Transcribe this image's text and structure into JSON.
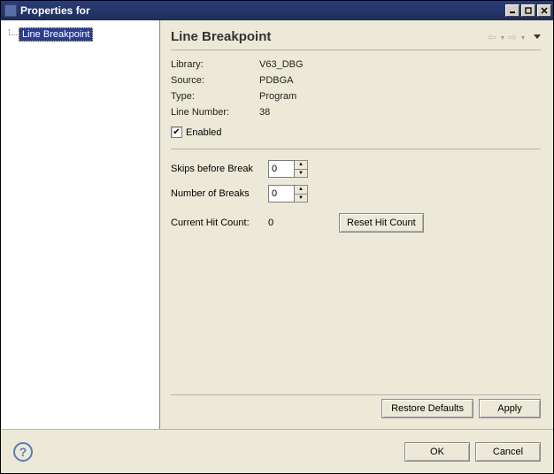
{
  "window": {
    "title": "Properties for"
  },
  "tree": {
    "selected": "Line Breakpoint"
  },
  "page": {
    "title": "Line Breakpoint"
  },
  "props": {
    "library_label": "Library:",
    "library_value": "V63_DBG",
    "source_label": "Source:",
    "source_value": "PDBGA",
    "type_label": "Type:",
    "type_value": "Program",
    "line_label": "Line Number:",
    "line_value": "38",
    "enabled_label": "Enabled"
  },
  "spinners": {
    "skips_label": "Skips before Break",
    "skips_value": "0",
    "breaks_label": "Number of Breaks",
    "breaks_value": "0"
  },
  "hitcount": {
    "label": "Current Hit Count:",
    "value": "0",
    "reset_label": "Reset Hit Count"
  },
  "footer": {
    "restore": "Restore Defaults",
    "apply": "Apply"
  },
  "bottom": {
    "ok": "OK",
    "cancel": "Cancel"
  }
}
